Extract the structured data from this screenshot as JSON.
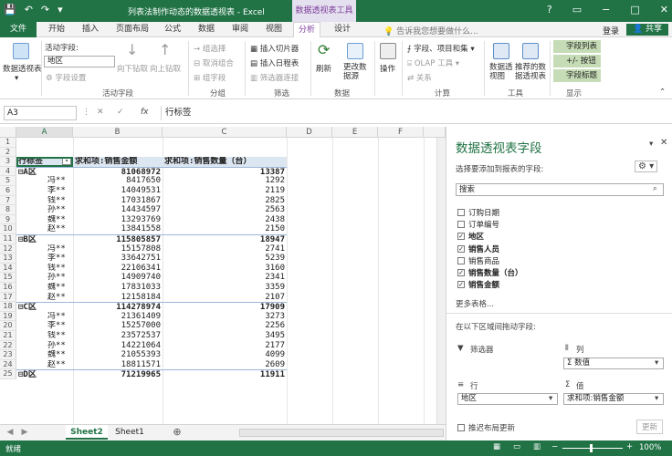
{
  "window": {
    "title": "列表法制作动态的数据透视表 - Excel",
    "context_tab_title": "数据透视表工具",
    "qat": [
      "💾",
      "↶",
      "↷",
      "▾"
    ],
    "controls": [
      "?",
      "▭",
      "−",
      "□",
      "✕"
    ]
  },
  "tabs": {
    "file": "文件",
    "items": [
      "开始",
      "插入",
      "页面布局",
      "公式",
      "数据",
      "审阅",
      "视图",
      "分析",
      "设计"
    ],
    "tellme": "告诉我您想要做什么...",
    "login": "登录",
    "share": "共享"
  },
  "ribbon": {
    "pivot_table_btn": "数据透视表",
    "active_field_label": "活动字段:",
    "active_field_value": "地区",
    "field_settings": "字段设置",
    "drill_down": "向下钻取",
    "drill_up": "向上钻取",
    "group_active_field": "活动字段",
    "group_selection": "组选择",
    "ungroup": "取消组合",
    "group_field": "组字段",
    "group_group": "分组",
    "insert_slicer": "插入切片器",
    "insert_timeline": "插入日程表",
    "filter_connections": "筛选器连接",
    "group_filter": "筛选",
    "refresh": "刷新",
    "change_source": "更改数据源",
    "group_data": "数据",
    "actions": "操作",
    "fields_items_sets": "字段、项目和集",
    "olap_tools": "OLAP 工具",
    "relationships": "关系",
    "group_calc": "计算",
    "pivot_chart": "数据透视图",
    "recommended": "推荐的数据透视表",
    "group_tools": "工具",
    "field_list": "字段列表",
    "buttons_toggle": "+/- 按钮",
    "field_headers": "字段标题",
    "group_show": "显示"
  },
  "formula": {
    "namebox": "A3",
    "content": "行标签"
  },
  "columns": [
    "A",
    "B",
    "C",
    "D",
    "E",
    "F"
  ],
  "rows": [
    {
      "n": "1",
      "a": "",
      "b": "",
      "c": "",
      "t": "blank"
    },
    {
      "n": "2",
      "a": "",
      "b": "",
      "c": "",
      "t": "blank"
    },
    {
      "n": "3",
      "a": "行标签",
      "b": "求和项:销售金额",
      "c": "求和项:销售数量（台）",
      "t": "header"
    },
    {
      "n": "4",
      "a": "⊟A区",
      "b": "81068972",
      "c": "13387",
      "t": "region"
    },
    {
      "n": "5",
      "a": "冯**",
      "b": "8417650",
      "c": "1292",
      "t": "item"
    },
    {
      "n": "6",
      "a": "李**",
      "b": "14049531",
      "c": "2119",
      "t": "item"
    },
    {
      "n": "7",
      "a": "钱**",
      "b": "17031867",
      "c": "2825",
      "t": "item"
    },
    {
      "n": "8",
      "a": "孙**",
      "b": "14434597",
      "c": "2563",
      "t": "item"
    },
    {
      "n": "9",
      "a": "魏**",
      "b": "13293769",
      "c": "2438",
      "t": "item"
    },
    {
      "n": "10",
      "a": "赵**",
      "b": "13841558",
      "c": "2150",
      "t": "item"
    },
    {
      "n": "11",
      "a": "⊟B区",
      "b": "115805857",
      "c": "18947",
      "t": "region"
    },
    {
      "n": "12",
      "a": "冯**",
      "b": "15157808",
      "c": "2741",
      "t": "item"
    },
    {
      "n": "13",
      "a": "李**",
      "b": "33642751",
      "c": "5239",
      "t": "item"
    },
    {
      "n": "14",
      "a": "钱**",
      "b": "22106341",
      "c": "3160",
      "t": "item"
    },
    {
      "n": "15",
      "a": "孙**",
      "b": "14909740",
      "c": "2341",
      "t": "item"
    },
    {
      "n": "16",
      "a": "魏**",
      "b": "17831033",
      "c": "3359",
      "t": "item"
    },
    {
      "n": "17",
      "a": "赵**",
      "b": "12158184",
      "c": "2107",
      "t": "item"
    },
    {
      "n": "18",
      "a": "⊟C区",
      "b": "114278974",
      "c": "17909",
      "t": "region"
    },
    {
      "n": "19",
      "a": "冯**",
      "b": "21361409",
      "c": "3273",
      "t": "item"
    },
    {
      "n": "20",
      "a": "李**",
      "b": "15257000",
      "c": "2256",
      "t": "item"
    },
    {
      "n": "21",
      "a": "钱**",
      "b": "23572537",
      "c": "3495",
      "t": "item"
    },
    {
      "n": "22",
      "a": "孙**",
      "b": "14221064",
      "c": "2177",
      "t": "item"
    },
    {
      "n": "23",
      "a": "魏**",
      "b": "21055393",
      "c": "4099",
      "t": "item"
    },
    {
      "n": "24",
      "a": "赵**",
      "b": "18811571",
      "c": "2609",
      "t": "item"
    },
    {
      "n": "25",
      "a": "⊟D区",
      "b": "71219965",
      "c": "11911",
      "t": "region"
    }
  ],
  "sheets": [
    "Sheet2",
    "Sheet1"
  ],
  "status": {
    "ready": "就绪",
    "zoom": "100%"
  },
  "panel": {
    "title": "数据透视表字段",
    "choose_label": "选择要添加到报表的字段:",
    "search_placeholder": "搜索",
    "fields": [
      {
        "label": "订购日期",
        "checked": false
      },
      {
        "label": "订单编号",
        "checked": false
      },
      {
        "label": "地区",
        "checked": true
      },
      {
        "label": "销售人员",
        "checked": true
      },
      {
        "label": "销售商品",
        "checked": false
      },
      {
        "label": "销售数量（台）",
        "checked": true
      },
      {
        "label": "销售金额",
        "checked": true
      }
    ],
    "more_tables": "更多表格...",
    "drag_label": "在以下区域间拖动字段:",
    "filters_label": "筛选器",
    "columns_label": "列",
    "columns_value": "Σ 数值",
    "rows_label": "行",
    "rows_value": "地区",
    "values_label": "值",
    "values_value": "求和项:销售金额",
    "defer_label": "推迟布局更新",
    "update_btn": "更新"
  },
  "colors": {
    "excel_green": "#217346",
    "context_purple": "#7d3c9a",
    "header_fill": "#dce6f1"
  }
}
